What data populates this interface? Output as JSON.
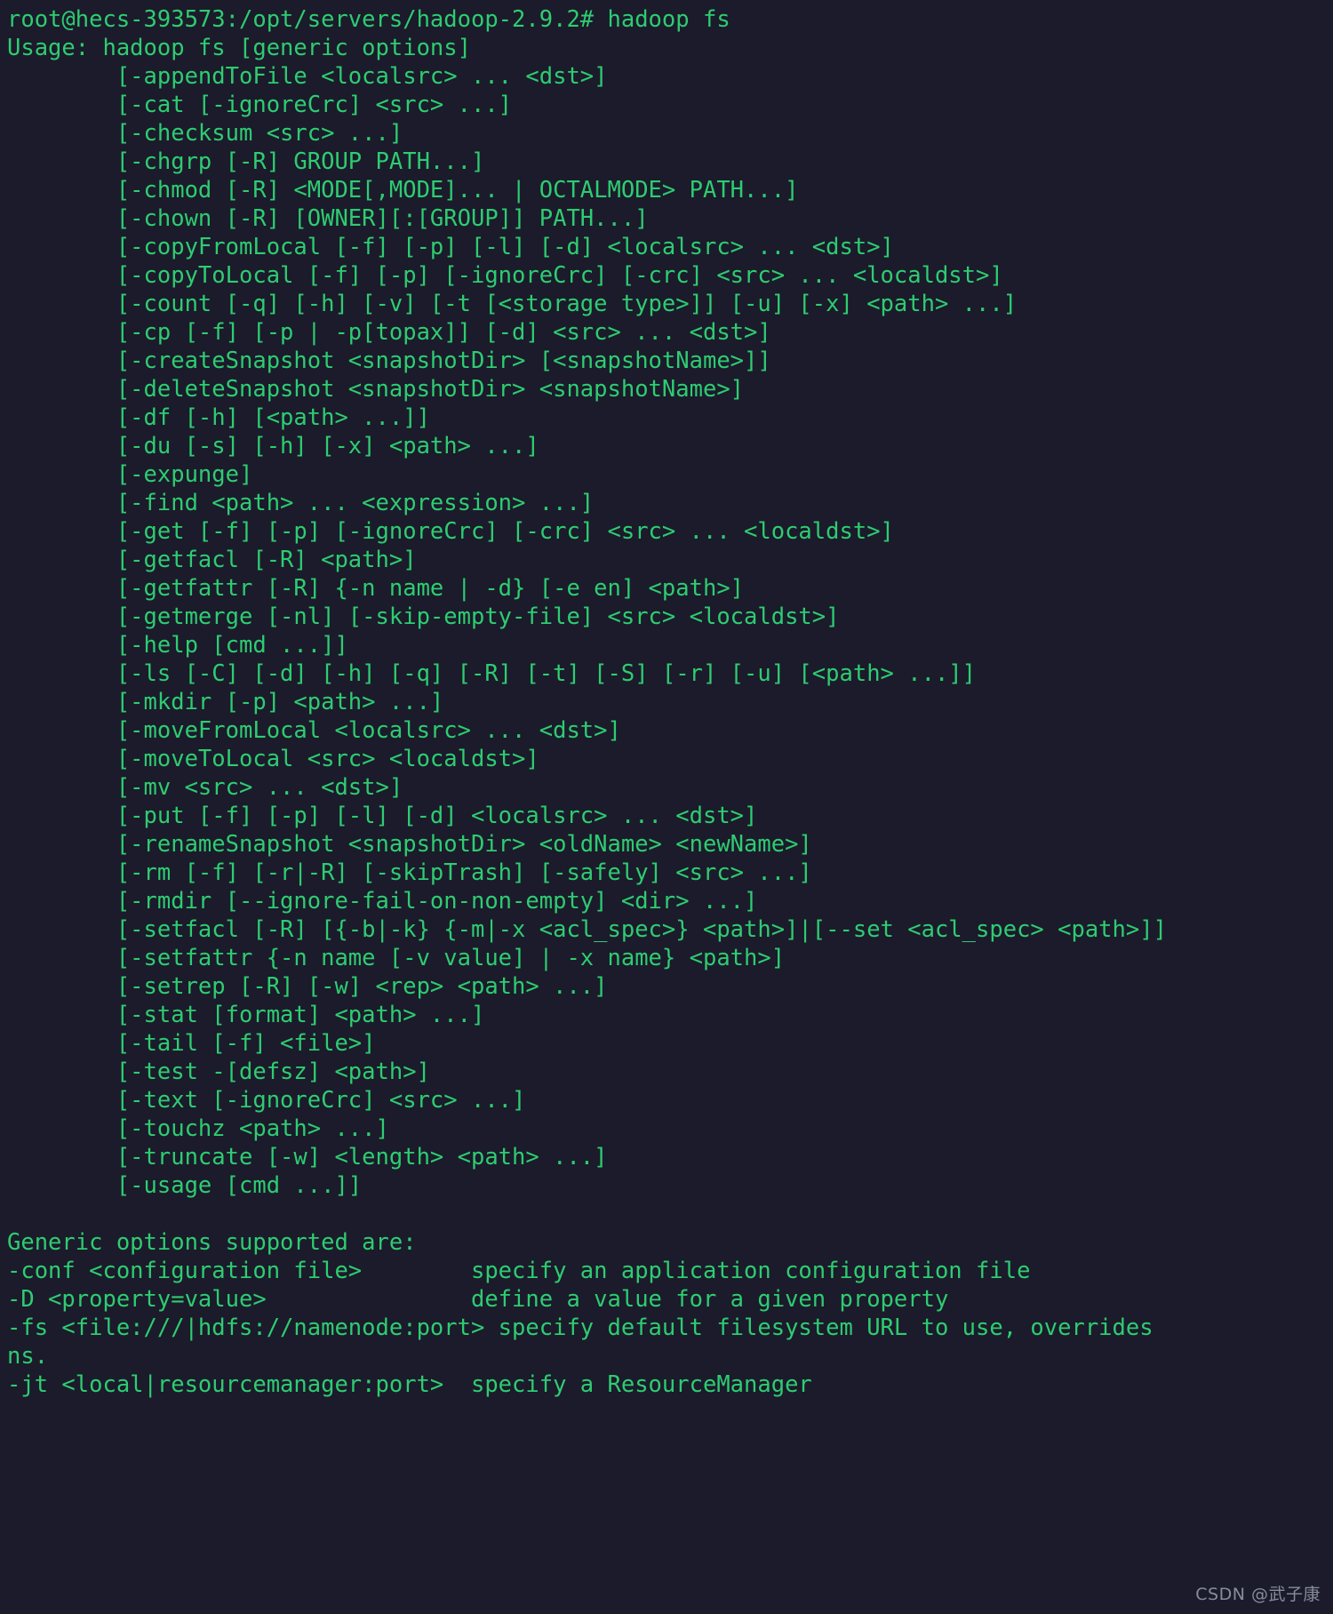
{
  "terminal": {
    "background_color": "#1b1b2b",
    "text_color": "#2ecc71",
    "prompt_line": "root@hecs-393573:/opt/servers/hadoop-2.9.2# hadoop fs",
    "lines": [
      "root@hecs-393573:/opt/servers/hadoop-2.9.2# hadoop fs",
      "Usage: hadoop fs [generic options]",
      "\t[-appendToFile <localsrc> ... <dst>]",
      "\t[-cat [-ignoreCrc] <src> ...]",
      "\t[-checksum <src> ...]",
      "\t[-chgrp [-R] GROUP PATH...]",
      "\t[-chmod [-R] <MODE[,MODE]... | OCTALMODE> PATH...]",
      "\t[-chown [-R] [OWNER][:[GROUP]] PATH...]",
      "\t[-copyFromLocal [-f] [-p] [-l] [-d] <localsrc> ... <dst>]",
      "\t[-copyToLocal [-f] [-p] [-ignoreCrc] [-crc] <src> ... <localdst>]",
      "\t[-count [-q] [-h] [-v] [-t [<storage type>]] [-u] [-x] <path> ...]",
      "\t[-cp [-f] [-p | -p[topax]] [-d] <src> ... <dst>]",
      "\t[-createSnapshot <snapshotDir> [<snapshotName>]]",
      "\t[-deleteSnapshot <snapshotDir> <snapshotName>]",
      "\t[-df [-h] [<path> ...]]",
      "\t[-du [-s] [-h] [-x] <path> ...]",
      "\t[-expunge]",
      "\t[-find <path> ... <expression> ...]",
      "\t[-get [-f] [-p] [-ignoreCrc] [-crc] <src> ... <localdst>]",
      "\t[-getfacl [-R] <path>]",
      "\t[-getfattr [-R] {-n name | -d} [-e en] <path>]",
      "\t[-getmerge [-nl] [-skip-empty-file] <src> <localdst>]",
      "\t[-help [cmd ...]]",
      "\t[-ls [-C] [-d] [-h] [-q] [-R] [-t] [-S] [-r] [-u] [<path> ...]]",
      "\t[-mkdir [-p] <path> ...]",
      "\t[-moveFromLocal <localsrc> ... <dst>]",
      "\t[-moveToLocal <src> <localdst>]",
      "\t[-mv <src> ... <dst>]",
      "\t[-put [-f] [-p] [-l] [-d] <localsrc> ... <dst>]",
      "\t[-renameSnapshot <snapshotDir> <oldName> <newName>]",
      "\t[-rm [-f] [-r|-R] [-skipTrash] [-safely] <src> ...]",
      "\t[-rmdir [--ignore-fail-on-non-empty] <dir> ...]",
      "\t[-setfacl [-R] [{-b|-k} {-m|-x <acl_spec>} <path>]|[--set <acl_spec> <path>]]",
      "\t[-setfattr {-n name [-v value] | -x name} <path>]",
      "\t[-setrep [-R] [-w] <rep> <path> ...]",
      "\t[-stat [format] <path> ...]",
      "\t[-tail [-f] <file>]",
      "\t[-test -[defsz] <path>]",
      "\t[-text [-ignoreCrc] <src> ...]",
      "\t[-touchz <path> ...]",
      "\t[-truncate [-w] <length> <path> ...]",
      "\t[-usage [cmd ...]]",
      "",
      "Generic options supported are:",
      "-conf <configuration file>        specify an application configuration file",
      "-D <property=value>               define a value for a given property",
      "-fs <file:///|hdfs://namenode:port> specify default filesystem URL to use, overrides",
      "ns.",
      "-jt <local|resourcemanager:port>  specify a ResourceManager"
    ]
  },
  "watermark": {
    "text": "CSDN @武子康"
  }
}
